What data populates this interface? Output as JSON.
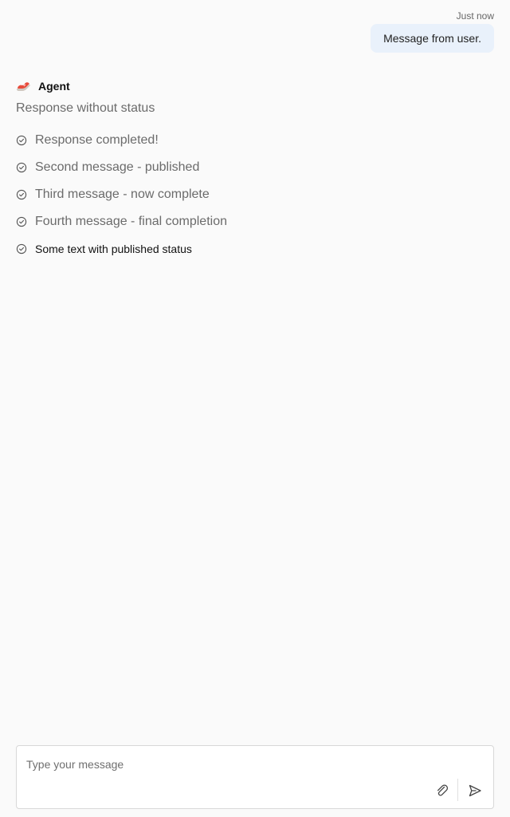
{
  "conversation": {
    "timestamp": "Just now",
    "user_message": "Message from user.",
    "agent": {
      "name": "Agent",
      "avatar_icon": "shoe-icon",
      "response_without_status": "Response without status",
      "status_messages": [
        {
          "text": "Response completed!",
          "icon": "check-circle-icon"
        },
        {
          "text": "Second message - published",
          "icon": "check-circle-icon"
        },
        {
          "text": "Third message - now complete",
          "icon": "check-circle-icon"
        },
        {
          "text": "Fourth message - final completion",
          "icon": "check-circle-icon"
        },
        {
          "text": "Some text with published status",
          "icon": "check-circle-icon"
        }
      ]
    }
  },
  "composer": {
    "placeholder": "Type your message",
    "value": "",
    "attach_icon": "paperclip-icon",
    "send_icon": "send-icon"
  },
  "colors": {
    "background": "#fafafa",
    "user_bubble": "#e9f1fb",
    "muted_text": "#6b6b6b",
    "primary_text": "#111111"
  }
}
